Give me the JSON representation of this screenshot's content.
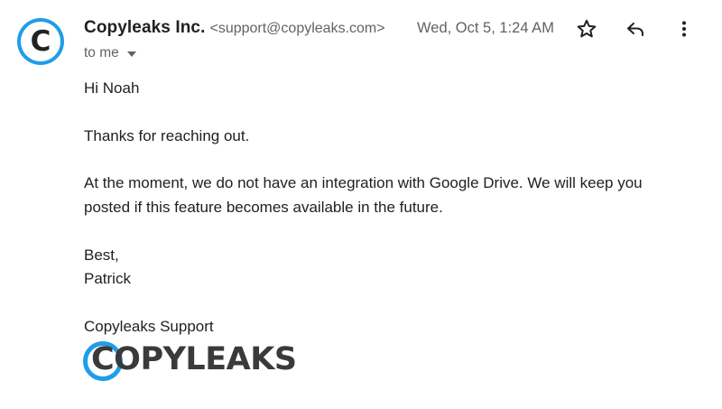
{
  "message": {
    "avatar_letter": "C",
    "sender_name": "Copyleaks Inc.",
    "sender_email": "<support@copyleaks.com>",
    "date": "Wed, Oct 5, 1:24 AM",
    "recipient": "to me"
  },
  "body": {
    "greeting": "Hi Noah",
    "thanks": "Thanks for reaching out.",
    "para_line1": "At the moment, we do not have an integration with Google Drive. We will keep you",
    "para_line2": "posted if this feature becomes available in the future.",
    "signoff": "Best,",
    "signer": "Patrick",
    "team": "Copyleaks Support"
  },
  "logo": {
    "text": "COPYLEAKS",
    "brand_color": "#1e9ee8"
  },
  "icons": [
    "star-icon",
    "reply-icon",
    "more-vert-icon",
    "chevron-down-icon"
  ]
}
